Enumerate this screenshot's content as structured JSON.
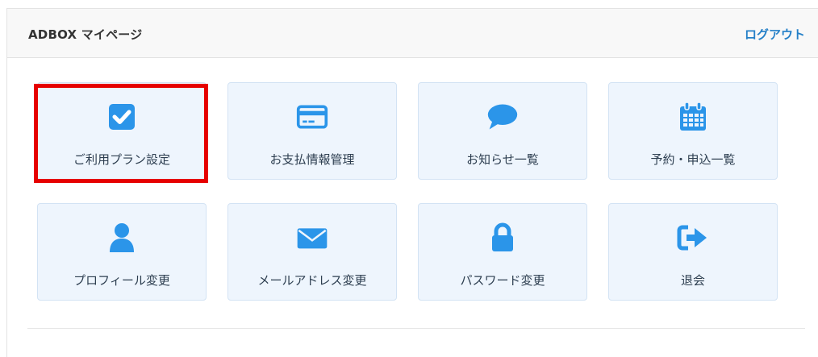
{
  "header": {
    "title": "ADBOX マイページ",
    "logout_label": "ログアウト"
  },
  "colors": {
    "accent": "#2b95e9",
    "tile_bg": "#eef5fd",
    "highlight": "#e60000"
  },
  "menu": {
    "items": [
      {
        "label": "ご利用プラン設定",
        "icon": "checkbox-icon"
      },
      {
        "label": "お支払情報管理",
        "icon": "credit-card-icon"
      },
      {
        "label": "お知らせ一覧",
        "icon": "speech-bubble-icon"
      },
      {
        "label": "予約・申込一覧",
        "icon": "calendar-icon"
      },
      {
        "label": "プロフィール変更",
        "icon": "user-icon"
      },
      {
        "label": "メールアドレス変更",
        "icon": "envelope-icon"
      },
      {
        "label": "パスワード変更",
        "icon": "lock-icon"
      },
      {
        "label": "退会",
        "icon": "sign-out-icon"
      }
    ]
  }
}
